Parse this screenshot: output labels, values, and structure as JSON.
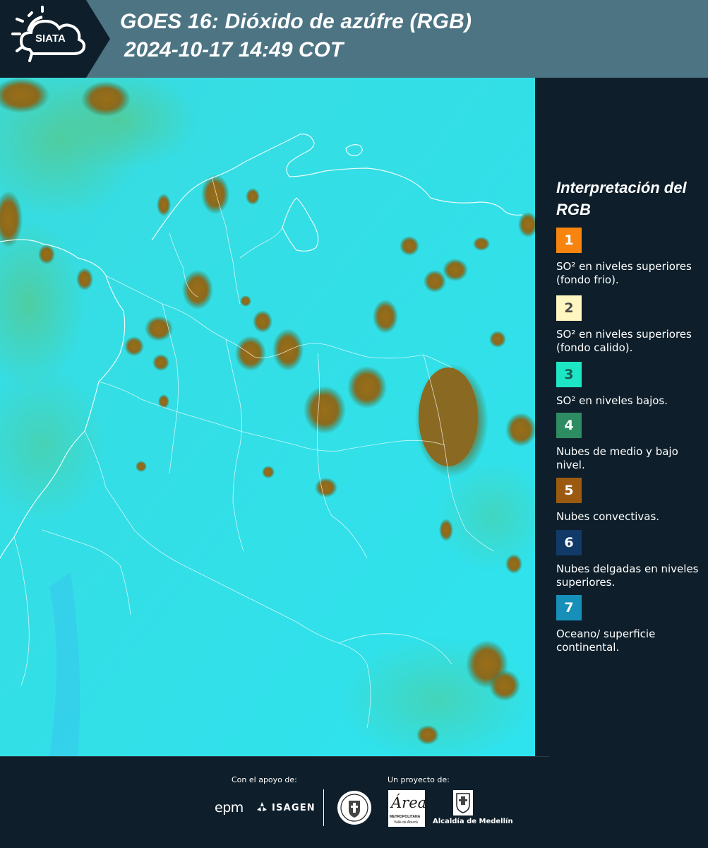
{
  "header": {
    "logo_text": "SIATA",
    "title_line1": "GOES 16: Dióxido de azúfre (RGB)",
    "title_line2": "2024-10-17 14:49 COT"
  },
  "map": {
    "description_icon": "satellite-rgb-map"
  },
  "legend": {
    "title": "Interpretación del RGB",
    "items": [
      {
        "number": "1",
        "text": "SO² en niveles superiores (fondo frio).",
        "color": "#f7840f",
        "num_color": "#ffffff"
      },
      {
        "number": "2",
        "text": "SO² en niveles superiores (fondo calido).",
        "color": "#fff6c0",
        "num_color": "#4a4a4a"
      },
      {
        "number": "3",
        "text": "SO² en niveles bajos.",
        "color": "#1de6c4",
        "num_color": "#1d5a52"
      },
      {
        "number": "4",
        "text": "Nubes de medio y bajo nivel.",
        "color": "#2e8c63",
        "num_color": "#ffffff"
      },
      {
        "number": "5",
        "text": "Nubes convectivas.",
        "color": "#9b5a10",
        "num_color": "#ffffff"
      },
      {
        "number": "6",
        "text": "Nubes delgadas en niveles superiores.",
        "color": "#123a68",
        "num_color": "#ffffff"
      },
      {
        "number": "7",
        "text": "Oceano/ superficie continental.",
        "color": "#1690b8",
        "num_color": "#ffffff"
      }
    ]
  },
  "footer": {
    "support_label": "Con el apoyo de:",
    "project_label": "Un proyecto de:",
    "sponsor_epm": "epm",
    "sponsor_isagen": "ISAGEN",
    "area_logo_text": "Área",
    "area_logo_sub": "METROPOLITANA",
    "area_logo_sub2": "Valle de Aburrá",
    "alcaldia_text": "Alcaldía de Medellín"
  }
}
